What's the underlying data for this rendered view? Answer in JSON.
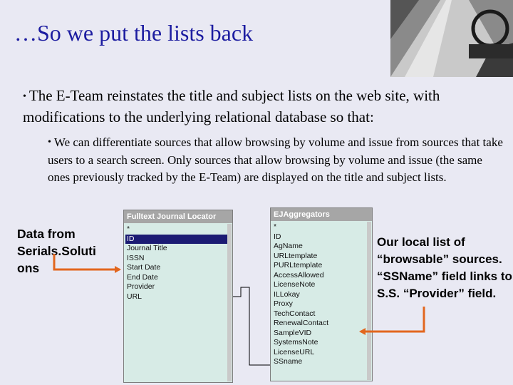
{
  "slide": {
    "title": "…So we put the lists back",
    "bullet1": "The E-Team reinstates the title and subject lists on the web site, with modifications to the underlying relational database so that:",
    "bullet2": "We can differentiate sources that allow browsing by volume and issue from sources that take users to a search screen.  Only sources that allow browsing by volume and issue (the same ones previously tracked by the E-Team) are displayed on the title and subject lists.",
    "bullet_glyph": "•"
  },
  "notes": {
    "left": "Data from Serials.Soluti ons",
    "right": "Our local list of “browsable” sources. “SSName” field links to S.S. “Provider” field."
  },
  "tables": {
    "fulltext": {
      "header": "Fulltext Journal Locator",
      "fields": [
        "*",
        "ID",
        "Journal Title",
        "ISSN",
        "Start Date",
        "End Date",
        "Provider",
        "URL"
      ]
    },
    "ejaggregators": {
      "header": "EJAggregators",
      "fields": [
        "*",
        "ID",
        "AgName",
        "URLtemplate",
        "PURLtemplate",
        "AccessAllowed",
        "LicenseNote",
        "ILLokay",
        "Proxy",
        "TechContact",
        "RenewalContact",
        "SampleVID",
        "SystemsNote",
        "LicenseURL",
        "SSname"
      ]
    }
  },
  "colors": {
    "title": "#1c1ca0",
    "arrow": "#e2661e",
    "table_bg": "#d7ebe6"
  }
}
